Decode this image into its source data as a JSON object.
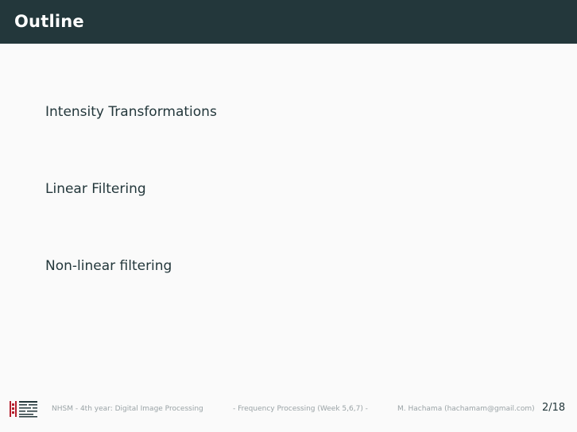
{
  "slide": {
    "title": "Outline",
    "items": [
      {
        "label": "Intensity Transformations"
      },
      {
        "label": "Linear Filtering"
      },
      {
        "label": "Non-linear filtering"
      }
    ]
  },
  "footer": {
    "course": "NHSM - 4th year: Digital Image Processing",
    "section": "- Frequency Processing (Week 5,6,7) -",
    "author": "M. Hachama (hachamam@gmail.com)",
    "page": "2/18",
    "logo_icon": "institution-logo-icon"
  },
  "colors": {
    "header_bg": "#23373b",
    "header_text": "#ffffff",
    "body_text": "#23373b",
    "footer_text": "#9aa3a6",
    "background": "#fafafa",
    "logo_accent": "#b5202e"
  }
}
